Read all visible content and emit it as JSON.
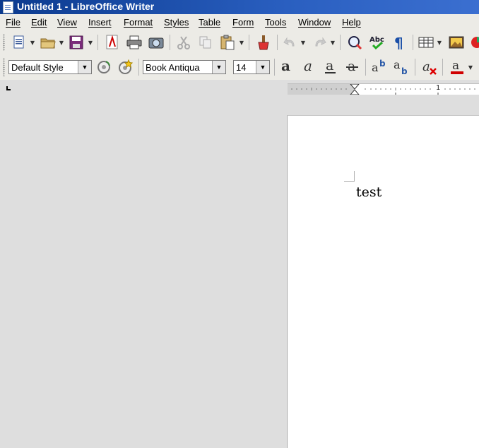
{
  "window": {
    "title": "Untitled 1 - LibreOffice Writer"
  },
  "menu": [
    "File",
    "Edit",
    "View",
    "Insert",
    "Format",
    "Styles",
    "Table",
    "Form",
    "Tools",
    "Window",
    "Help"
  ],
  "formatting": {
    "paragraph_style": "Default Style",
    "font_name": "Book Antiqua",
    "font_size": "14"
  },
  "ruler": {
    "mark_1": "1"
  },
  "document": {
    "text": "test"
  },
  "colors": {
    "title_bar": "#0b3a8e",
    "font_color_bar": "#d00000"
  }
}
